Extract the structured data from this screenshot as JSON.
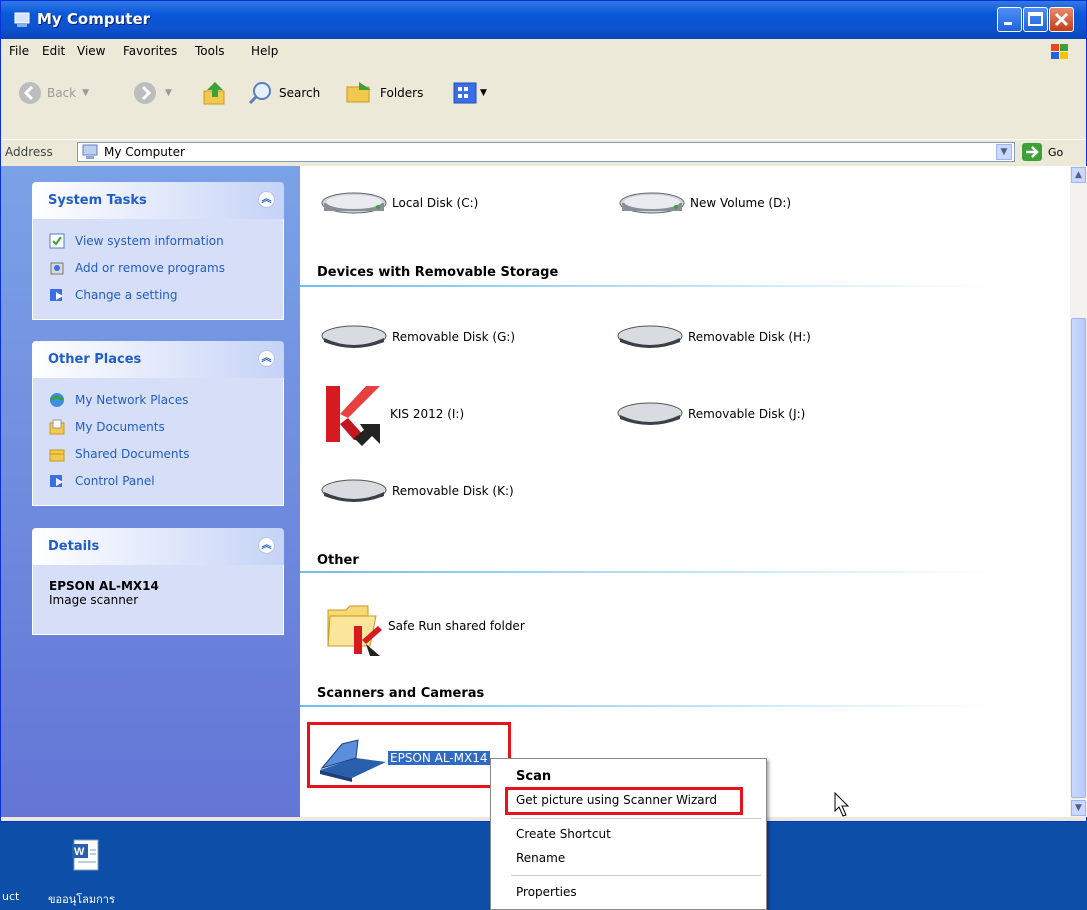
{
  "window": {
    "title": "My Computer"
  },
  "menu": [
    "File",
    "Edit",
    "View",
    "Favorites",
    "Tools",
    "Help"
  ],
  "toolbar": {
    "back": "Back",
    "search": "Search",
    "folders": "Folders"
  },
  "address": {
    "label": "Address",
    "value": "My Computer",
    "go": "Go"
  },
  "left_pane": {
    "system_tasks": {
      "title": "System Tasks",
      "items": [
        "View system information",
        "Add or remove programs",
        "Change a setting"
      ]
    },
    "other_places": {
      "title": "Other Places",
      "items": [
        "My Network Places",
        "My Documents",
        "Shared Documents",
        "Control Panel"
      ]
    },
    "details": {
      "title": "Details",
      "name": "EPSON AL-MX14",
      "type": "Image scanner"
    }
  },
  "content": {
    "hard_drives": [
      "Local Disk (C:)",
      "New Volume (D:)"
    ],
    "removable_header": "Devices with Removable Storage",
    "removable": [
      "Removable Disk (G:)",
      "Removable Disk (H:)",
      "KIS 2012 (I:)",
      "Removable Disk (J:)",
      "Removable Disk (K:)"
    ],
    "other_header": "Other",
    "other": [
      "Safe Run shared folder"
    ],
    "scanners_header": "Scanners and Cameras",
    "scanner": "EPSON AL-MX14"
  },
  "context_menu": {
    "items": [
      "Scan",
      "Get picture using Scanner Wizard",
      "Create Shortcut",
      "Rename",
      "Properties"
    ]
  },
  "taskbar": {
    "left_fragment": "uct",
    "desktop_icon_label": "ขออนุโลมการ"
  },
  "colors": {
    "title_blue": "#0a58d8",
    "link_blue": "#215dc6",
    "highlight_red": "#e8121a",
    "selection_blue": "#316ac5"
  }
}
